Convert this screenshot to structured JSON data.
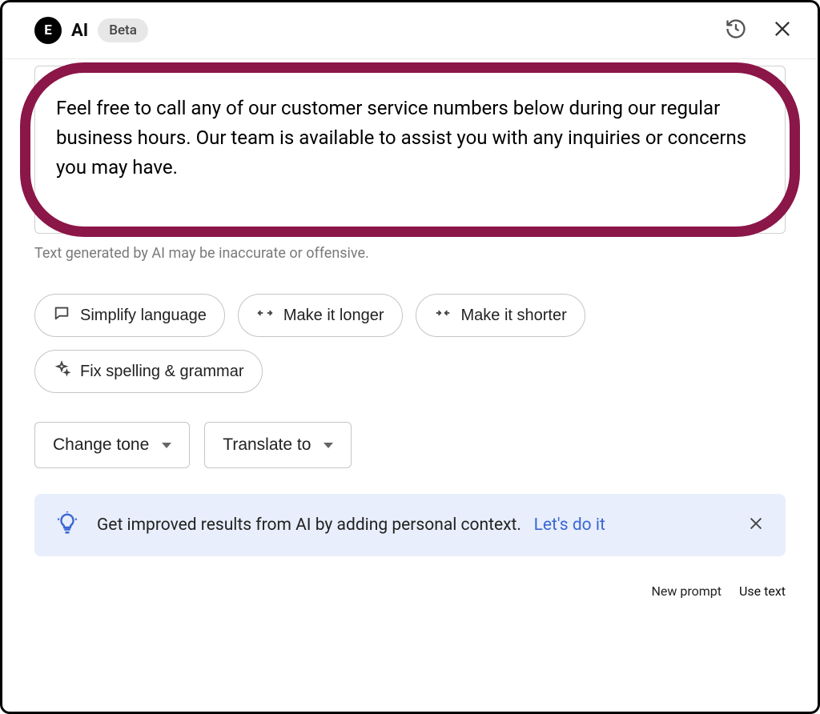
{
  "header": {
    "logo_text": "E",
    "title": "AI",
    "beta_label": "Beta"
  },
  "main": {
    "generated_text": "Feel free to call any of our customer service numbers below during our regular business hours. Our team is available to assist you with any inquiries or concerns you may have.",
    "disclaimer": "Text generated by AI may be inaccurate or offensive."
  },
  "actions": {
    "simplify": "Simplify language",
    "longer": "Make it longer",
    "shorter": "Make it shorter",
    "fix_grammar": "Fix spelling & grammar"
  },
  "dropdowns": {
    "change_tone": "Change tone",
    "translate_to": "Translate to"
  },
  "banner": {
    "text": "Get improved results from AI by adding personal context.",
    "link": "Let's do it"
  },
  "footer": {
    "new_prompt": "New prompt",
    "use_text": "Use text"
  }
}
